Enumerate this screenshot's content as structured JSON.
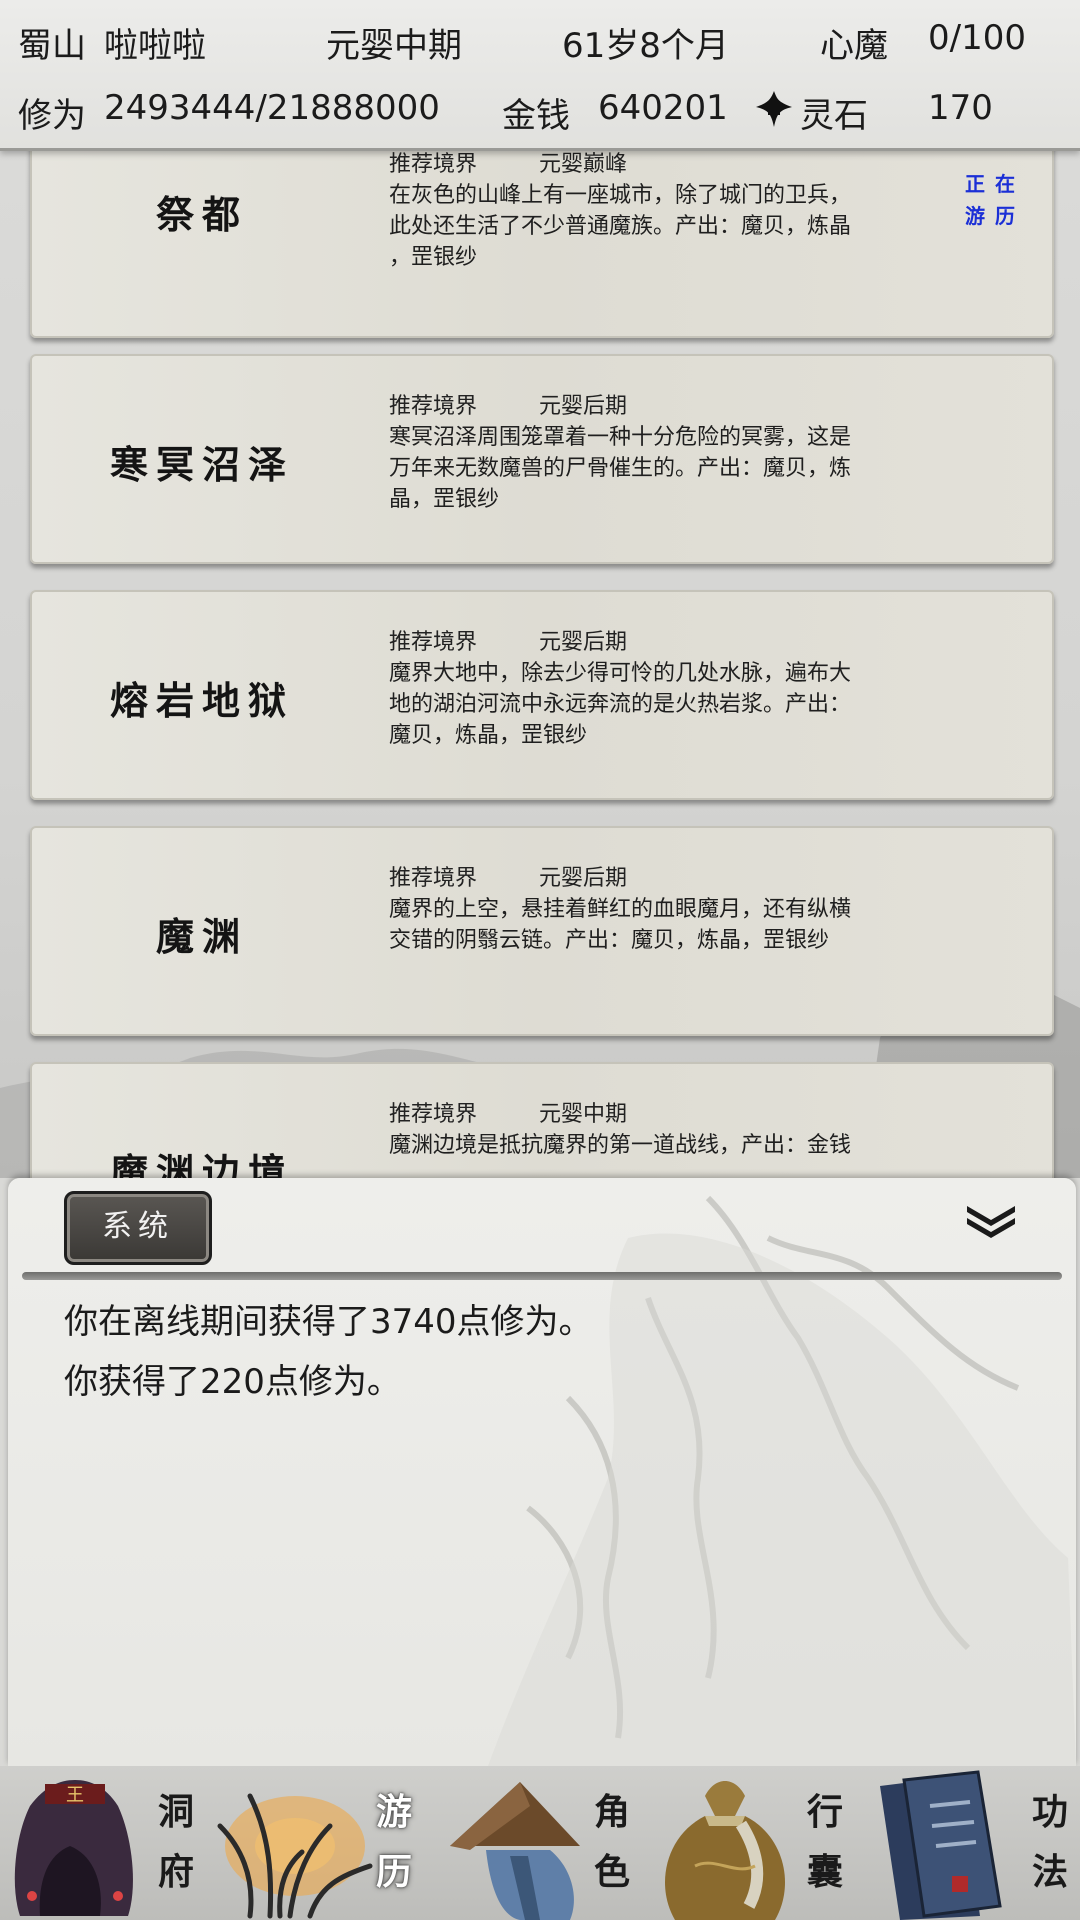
{
  "header": {
    "location": "蜀山",
    "player_name": "啦啦啦",
    "realm": "元婴中期",
    "age": "61岁8个月",
    "heart_demon_label": "心魔",
    "heart_demon_value": "0/100",
    "cultivation_label": "修为",
    "cultivation_value": "2493444/21888000",
    "money_label": "金钱",
    "money_value": "640201",
    "spirit_stone_label": "灵石",
    "spirit_stone_value": "170"
  },
  "locations": [
    {
      "name": "祭都",
      "rec_label": "推荐境界",
      "rec_value": "元婴巅峰",
      "desc1": "在灰色的山峰上有一座城市，除了城门的卫兵，",
      "desc2": "此处还生活了不少普通魔族。产出：魔贝，炼晶",
      "desc3": "，罡银纱",
      "status1": "正在",
      "status2": "游历"
    },
    {
      "name": "寒冥沼泽",
      "rec_label": "推荐境界",
      "rec_value": "元婴后期",
      "desc1": "寒冥沼泽周围笼罩着一种十分危险的冥雾，这是",
      "desc2": "万年来无数魔兽的尸骨催生的。产出：魔贝，炼",
      "desc3": "晶，罡银纱"
    },
    {
      "name": "熔岩地狱",
      "rec_label": "推荐境界",
      "rec_value": "元婴后期",
      "desc1": "魔界大地中，除去少得可怜的几处水脉，遍布大",
      "desc2": "地的湖泊河流中永远奔流的是火热岩浆。产出：",
      "desc3": "魔贝，炼晶，罡银纱"
    },
    {
      "name": "魔渊",
      "rec_label": "推荐境界",
      "rec_value": "元婴后期",
      "desc1": "魔界的上空，悬挂着鲜红的血眼魔月，还有纵横",
      "desc2": "交错的阴翳云链。产出：魔贝，炼晶，罡银纱",
      "desc3": ""
    },
    {
      "name": "魔渊边境",
      "rec_label": "推荐境界",
      "rec_value": "元婴中期",
      "desc1": "魔渊边境是抵抗魔界的第一道战线，产出：金钱",
      "desc2": "",
      "desc3": ""
    }
  ],
  "panel": {
    "tab_label": "系统",
    "messages": [
      "你在离线期间获得了3740点修为。",
      "你获得了220点修为。"
    ]
  },
  "nav": [
    {
      "top": "洞",
      "bottom": "府",
      "icon": "cave-dwelling-icon"
    },
    {
      "top": "游",
      "bottom": "历",
      "icon": "travel-grass-icon",
      "active": true
    },
    {
      "top": "角",
      "bottom": "色",
      "icon": "character-straw-hat-icon"
    },
    {
      "top": "行",
      "bottom": "囊",
      "icon": "bag-icon"
    },
    {
      "top": "功",
      "bottom": "法",
      "icon": "technique-book-icon"
    }
  ],
  "colors": {
    "status_blue": "#1b2fd6",
    "card_bg": "#e3e1d9",
    "tab_dark": "#3f3d3a"
  }
}
